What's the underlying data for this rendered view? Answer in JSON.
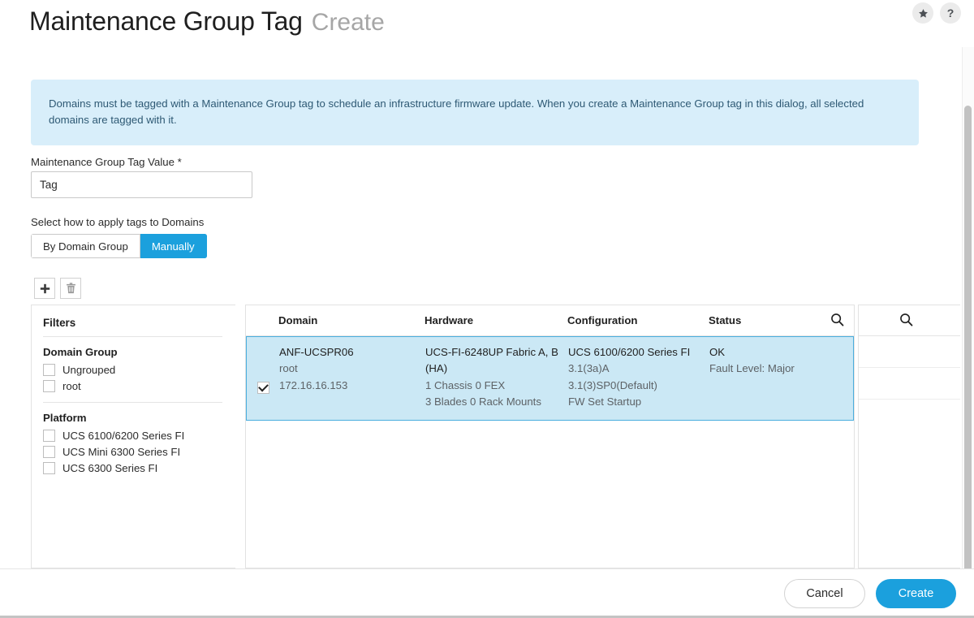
{
  "header": {
    "title_main": "Maintenance Group Tag",
    "title_sub": "Create",
    "icons": {
      "favorite": "star-icon",
      "help": "help-icon",
      "help_glyph": "?"
    }
  },
  "banner": {
    "text": "Domains must be tagged with a Maintenance Group tag to schedule an infrastructure firmware update. When you create a Maintenance Group tag in this dialog, all selected domains are tagged with it.",
    "background_color": "#d8eefa",
    "text_color": "#2e5974"
  },
  "form": {
    "tag_value_label": "Maintenance Group Tag Value",
    "required_marker": "*",
    "tag_value": "Tag",
    "tag_placeholder": "Tag",
    "apply_label": "Select how to apply tags to Domains",
    "segments": [
      {
        "label": "By Domain Group",
        "active": false
      },
      {
        "label": "Manually",
        "active": true
      }
    ],
    "accent_color": "#1ba0dd"
  },
  "toolbar": {
    "add": "add-icon",
    "delete": "trash-icon"
  },
  "filters": {
    "title": "Filters",
    "groups": [
      {
        "title": "Domain Group",
        "options": [
          {
            "label": "Ungrouped",
            "checked": false
          },
          {
            "label": "root",
            "checked": false
          }
        ]
      },
      {
        "title": "Platform",
        "options": [
          {
            "label": "UCS 6100/6200 Series FI",
            "checked": false
          },
          {
            "label": "UCS Mini 6300 Series FI",
            "checked": false
          },
          {
            "label": "UCS 6300 Series FI",
            "checked": false
          }
        ]
      }
    ]
  },
  "table": {
    "columns": [
      "Domain",
      "Hardware",
      "Configuration",
      "Status"
    ],
    "search_icon": "search-icon",
    "rows": [
      {
        "selected": true,
        "checked": true,
        "domain": {
          "name": "ANF-UCSPR06",
          "group": "root",
          "ip": "172.16.16.153"
        },
        "hardware": {
          "model": "UCS-FI-6248UP Fabric A, B (HA)",
          "chassis": "1 Chassis 0 FEX",
          "blades": "3 Blades 0 Rack Mounts"
        },
        "configuration": {
          "platform": "UCS 6100/6200 Series FI",
          "version": "3.1(3a)A",
          "bundle": "3.1(3)SP0(Default)",
          "fw": "FW Set Startup"
        },
        "status": {
          "state": "OK",
          "fault": "Fault Level: Major"
        }
      }
    ],
    "selected_background": "#cbe8f5",
    "selected_border": "#4aaede"
  },
  "side_panel": {
    "search_icon": "search-icon"
  },
  "footer": {
    "cancel_label": "Cancel",
    "create_label": "Create"
  }
}
